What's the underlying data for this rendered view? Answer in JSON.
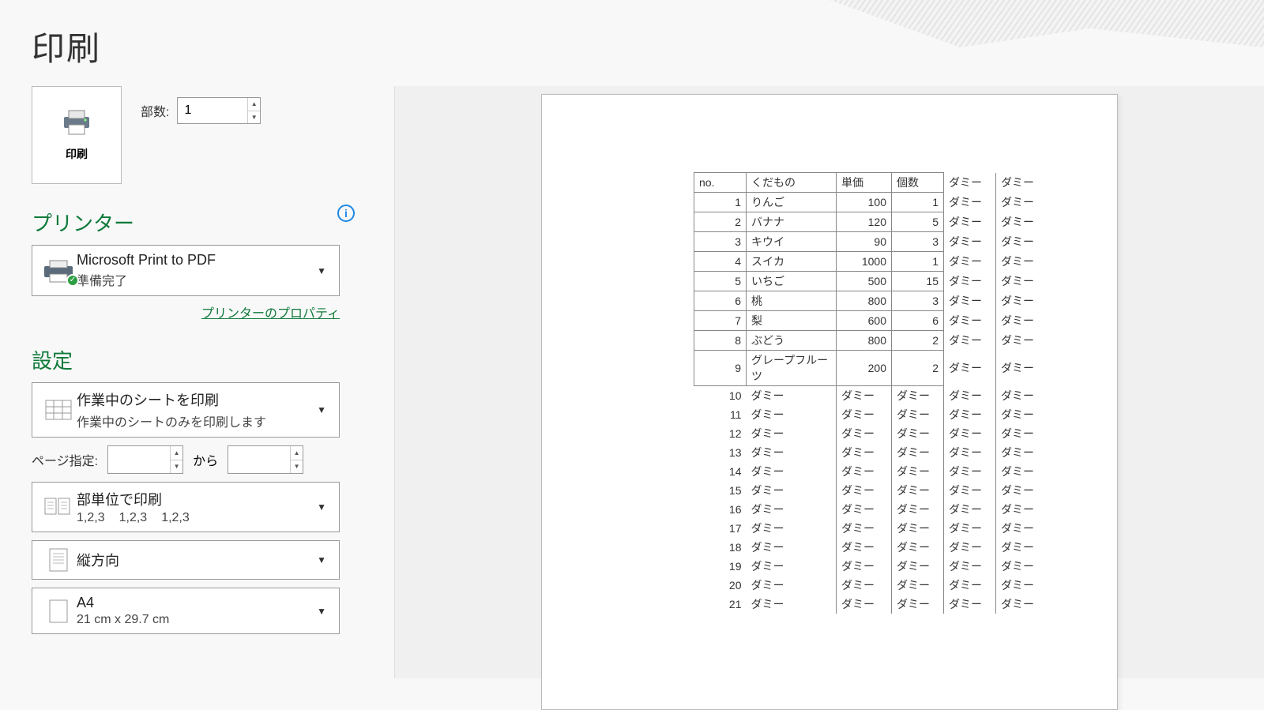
{
  "title": "印刷",
  "print": {
    "button_label": "印刷",
    "copies_label": "部数:",
    "copies_value": "1"
  },
  "printer": {
    "section": "プリンター",
    "name": "Microsoft Print to PDF",
    "status": "準備完了",
    "properties_link": "プリンターのプロパティ"
  },
  "settings": {
    "section": "設定",
    "what": {
      "line1": "作業中のシートを印刷",
      "line2": "作業中のシートのみを印刷します"
    },
    "page_spec_label": "ページ指定:",
    "page_from": "",
    "page_to_label": "から",
    "page_to": "",
    "collate": {
      "line1": "部単位で印刷",
      "seq": "1,2,3"
    },
    "orient": {
      "line1": "縦方向"
    },
    "paper": {
      "line1": "A4",
      "line2": "21 cm x 29.7 cm"
    }
  },
  "preview": {
    "headers": [
      "no.",
      "くだもの",
      "単価",
      "個数",
      "ダミー",
      "ダミー"
    ],
    "dummy": "ダミー",
    "rows_bordered": [
      {
        "no": 1,
        "name": "りんご",
        "price": 100,
        "qty": 1
      },
      {
        "no": 2,
        "name": "バナナ",
        "price": 120,
        "qty": 5
      },
      {
        "no": 3,
        "name": "キウイ",
        "price": 90,
        "qty": 3
      },
      {
        "no": 4,
        "name": "スイカ",
        "price": 1000,
        "qty": 1
      },
      {
        "no": 5,
        "name": "いちご",
        "price": 500,
        "qty": 15
      },
      {
        "no": 6,
        "name": "桃",
        "price": 800,
        "qty": 3
      },
      {
        "no": 7,
        "name": "梨",
        "price": 600,
        "qty": 6
      },
      {
        "no": 8,
        "name": "ぶどう",
        "price": 800,
        "qty": 2
      },
      {
        "no": 9,
        "name": "グレープフルーツ",
        "price": 200,
        "qty": 2
      }
    ],
    "rows_open_start": 10,
    "rows_open_end": 21
  }
}
